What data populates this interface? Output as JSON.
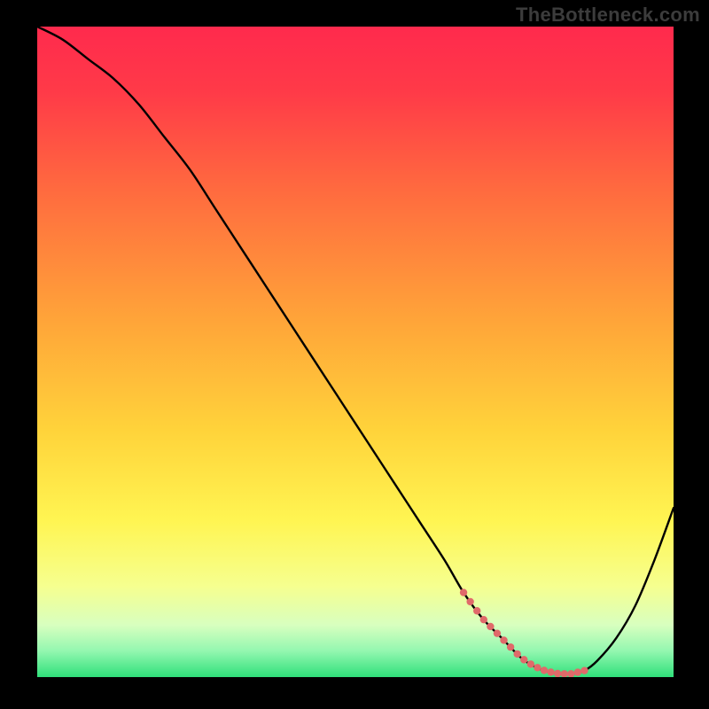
{
  "watermark": "TheBottleneck.com",
  "chart_data": {
    "type": "line",
    "title": "",
    "xlabel": "",
    "ylabel": "",
    "xlim": [
      0,
      100
    ],
    "ylim": [
      0,
      100
    ],
    "grid": false,
    "series": [
      {
        "name": "curve",
        "x": [
          0,
          4,
          8,
          12,
          16,
          20,
          24,
          28,
          32,
          36,
          40,
          44,
          48,
          52,
          56,
          60,
          64,
          67,
          70,
          73,
          76,
          78,
          80,
          82,
          84,
          86,
          88,
          91,
          94,
          97,
          100
        ],
        "y": [
          100,
          98,
          95,
          92,
          88,
          83,
          78,
          72,
          66,
          60,
          54,
          48,
          42,
          36,
          30,
          24,
          18,
          13,
          9,
          6,
          3,
          1.7,
          0.9,
          0.5,
          0.5,
          1.0,
          2.5,
          6,
          11,
          18,
          26
        ]
      }
    ],
    "dotted_range_x": [
      67,
      86
    ],
    "gradient_stops": [
      {
        "offset": 0,
        "color": "#ff2a4d"
      },
      {
        "offset": 10,
        "color": "#ff3a48"
      },
      {
        "offset": 25,
        "color": "#ff6a3f"
      },
      {
        "offset": 45,
        "color": "#ffa439"
      },
      {
        "offset": 62,
        "color": "#ffd33a"
      },
      {
        "offset": 76,
        "color": "#fff552"
      },
      {
        "offset": 86,
        "color": "#f6ff8f"
      },
      {
        "offset": 92,
        "color": "#d8ffbf"
      },
      {
        "offset": 96,
        "color": "#93f7b0"
      },
      {
        "offset": 100,
        "color": "#2fe07a"
      }
    ],
    "colors": {
      "background": "#000000",
      "curve": "#000000",
      "dots": "#e06a6a"
    }
  }
}
